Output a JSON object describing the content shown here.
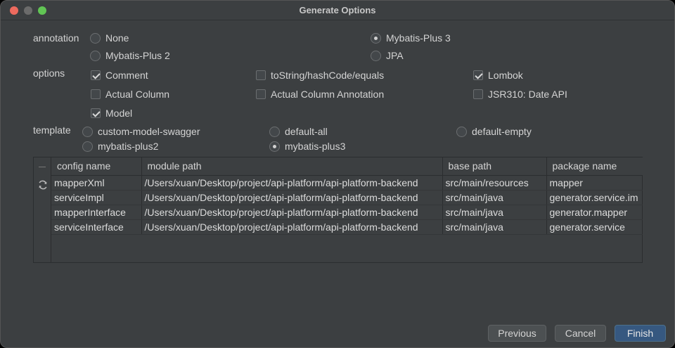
{
  "window": {
    "title": "Generate Options"
  },
  "annotation": {
    "label": "annotation",
    "options": [
      {
        "label": "None",
        "selected": false
      },
      {
        "label": "Mybatis-Plus 3",
        "selected": true
      },
      {
        "label": "Mybatis-Plus 2",
        "selected": false
      },
      {
        "label": "JPA",
        "selected": false
      }
    ]
  },
  "options": {
    "label": "options",
    "items": [
      {
        "label": "Comment",
        "checked": true
      },
      {
        "label": "toString/hashCode/equals",
        "checked": false
      },
      {
        "label": "Lombok",
        "checked": true
      },
      {
        "label": "Actual Column",
        "checked": false
      },
      {
        "label": "Actual Column Annotation",
        "checked": false
      },
      {
        "label": "JSR310: Date API",
        "checked": false
      },
      {
        "label": "Model",
        "checked": true
      }
    ]
  },
  "template": {
    "label": "template",
    "options": [
      {
        "label": "custom-model-swagger",
        "selected": false
      },
      {
        "label": "default-all",
        "selected": false
      },
      {
        "label": "default-empty",
        "selected": false
      },
      {
        "label": "mybatis-plus2",
        "selected": false
      },
      {
        "label": "mybatis-plus3",
        "selected": true
      }
    ]
  },
  "table": {
    "columns": [
      "config name",
      "module path",
      "base path",
      "package name"
    ],
    "rows": [
      [
        "mapperXml",
        "/Users/xuan/Desktop/project/api-platform/api-platform-backend",
        "src/main/resources",
        "mapper"
      ],
      [
        "serviceImpl",
        "/Users/xuan/Desktop/project/api-platform/api-platform-backend",
        "src/main/java",
        "generator.service.im"
      ],
      [
        "mapperInterface",
        "/Users/xuan/Desktop/project/api-platform/api-platform-backend",
        "src/main/java",
        "generator.mapper"
      ],
      [
        "serviceInterface",
        "/Users/xuan/Desktop/project/api-platform/api-platform-backend",
        "src/main/java",
        "generator.service"
      ]
    ]
  },
  "buttons": {
    "previous": "Previous",
    "cancel": "Cancel",
    "finish": "Finish"
  },
  "colors": {
    "background": "#3c3f41",
    "primary_button": "#365880"
  }
}
